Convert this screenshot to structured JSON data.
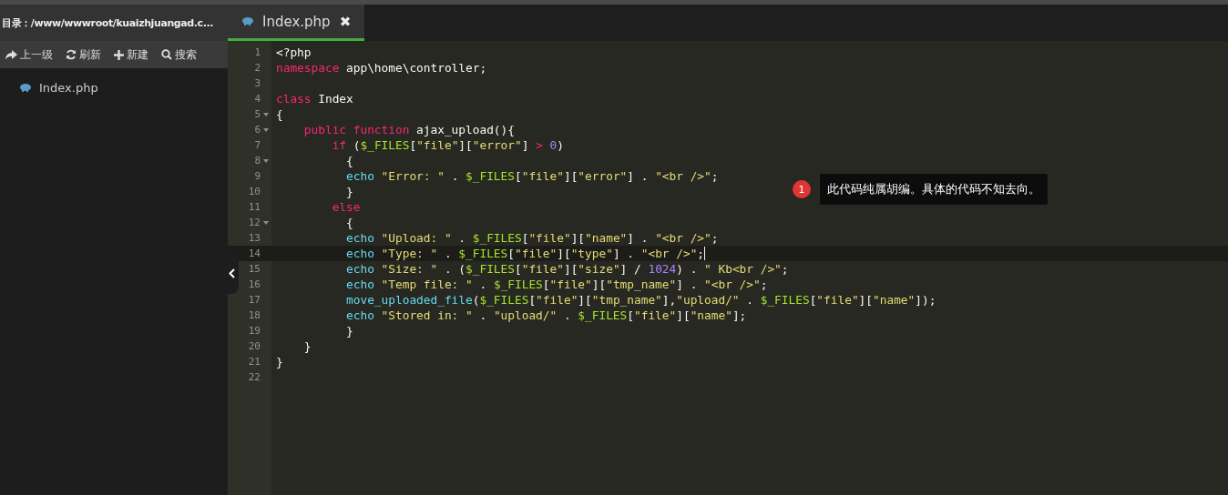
{
  "sidebar": {
    "path": "目录：/www/wwwroot/kuaizhjuangad.c...",
    "toolbar": [
      {
        "kind": "up",
        "label": "上一级"
      },
      {
        "kind": "refresh",
        "label": "刷新"
      },
      {
        "kind": "new",
        "label": "新建"
      },
      {
        "kind": "search",
        "label": "搜索"
      }
    ],
    "files": [
      {
        "name": "Index.php",
        "selected": false
      }
    ]
  },
  "tabs": [
    {
      "label": "Index.php",
      "close": "✖",
      "selected": true
    }
  ],
  "editor": {
    "lines": [
      {
        "number": "1",
        "fold": false,
        "active": false,
        "tokens": [
          {
            "kind": "plain",
            "text": "<?php"
          }
        ]
      },
      {
        "number": "2",
        "fold": false,
        "active": false,
        "tokens": [
          {
            "kind": "keyword",
            "text": "namespace"
          },
          {
            "kind": "plain",
            "text": " app\\home\\controller;"
          }
        ]
      },
      {
        "number": "3",
        "fold": false,
        "active": false
      },
      {
        "number": "4",
        "fold": false,
        "active": false,
        "tokens": [
          {
            "kind": "keyword",
            "text": "class"
          },
          {
            "kind": "plain",
            "text": " Index"
          }
        ]
      },
      {
        "number": "5",
        "fold": true,
        "active": false,
        "tokens": [
          {
            "kind": "plain",
            "text": "{"
          }
        ]
      },
      {
        "number": "6",
        "fold": true,
        "active": false,
        "tokens": [
          {
            "kind": "keyword",
            "text": "    public "
          },
          {
            "kind": "keyword",
            "text": "function"
          },
          {
            "kind": "plain",
            "text": " ajax_upload(){"
          }
        ]
      },
      {
        "number": "7",
        "fold": false,
        "active": false,
        "tokens": [
          {
            "kind": "keyword",
            "text": "        if"
          },
          {
            "kind": "plain",
            "text": " ("
          },
          {
            "kind": "variable",
            "text": "$_FILES"
          },
          {
            "kind": "plain",
            "text": "["
          },
          {
            "kind": "string",
            "text": "\"file\""
          },
          {
            "kind": "plain",
            "text": "]["
          },
          {
            "kind": "string",
            "text": "\"error\""
          },
          {
            "kind": "plain",
            "text": "] "
          },
          {
            "kind": "keyword",
            "text": "> "
          },
          {
            "kind": "number",
            "text": "0"
          },
          {
            "kind": "plain",
            "text": ")"
          }
        ]
      },
      {
        "number": "8",
        "fold": true,
        "active": false,
        "tokens": [
          {
            "kind": "plain",
            "text": "          {"
          }
        ]
      },
      {
        "number": "9",
        "fold": false,
        "active": false,
        "tokens": [
          {
            "kind": "builtin",
            "text": "          echo "
          },
          {
            "kind": "string",
            "text": "\"Error: \""
          },
          {
            "kind": "plain",
            "text": " . "
          },
          {
            "kind": "variable",
            "text": "$_FILES"
          },
          {
            "kind": "plain",
            "text": "["
          },
          {
            "kind": "string",
            "text": "\"file\""
          },
          {
            "kind": "plain",
            "text": "]["
          },
          {
            "kind": "string",
            "text": "\"error\""
          },
          {
            "kind": "plain",
            "text": "] . "
          },
          {
            "kind": "string",
            "text": "\"<br />\""
          },
          {
            "kind": "plain",
            "text": ";"
          }
        ]
      },
      {
        "number": "10",
        "fold": false,
        "active": false,
        "tokens": [
          {
            "kind": "plain",
            "text": "          }"
          }
        ]
      },
      {
        "number": "11",
        "fold": false,
        "active": false,
        "tokens": [
          {
            "kind": "keyword",
            "text": "        else"
          }
        ]
      },
      {
        "number": "12",
        "fold": true,
        "active": false,
        "tokens": [
          {
            "kind": "plain",
            "text": "          {"
          }
        ]
      },
      {
        "number": "13",
        "fold": false,
        "active": false,
        "tokens": [
          {
            "kind": "builtin",
            "text": "          echo "
          },
          {
            "kind": "string",
            "text": "\"Upload: \""
          },
          {
            "kind": "plain",
            "text": " . "
          },
          {
            "kind": "variable",
            "text": "$_FILES"
          },
          {
            "kind": "plain",
            "text": "["
          },
          {
            "kind": "string",
            "text": "\"file\""
          },
          {
            "kind": "plain",
            "text": "]["
          },
          {
            "kind": "string",
            "text": "\"name\""
          },
          {
            "kind": "plain",
            "text": "] . "
          },
          {
            "kind": "string",
            "text": "\"<br />\""
          },
          {
            "kind": "plain",
            "text": ";"
          }
        ]
      },
      {
        "number": "14",
        "fold": false,
        "active": true,
        "tokens": [
          {
            "kind": "builtin",
            "text": "          echo "
          },
          {
            "kind": "string",
            "text": "\"Type: \""
          },
          {
            "kind": "plain",
            "text": " . "
          },
          {
            "kind": "variable",
            "text": "$_FILES"
          },
          {
            "kind": "plain",
            "text": "["
          },
          {
            "kind": "string",
            "text": "\"file\""
          },
          {
            "kind": "plain",
            "text": "]["
          },
          {
            "kind": "string",
            "text": "\"type\""
          },
          {
            "kind": "plain",
            "text": "] . "
          },
          {
            "kind": "string",
            "text": "\"<br />\""
          },
          {
            "kind": "plain",
            "text": ";"
          }
        ]
      },
      {
        "number": "15",
        "fold": false,
        "active": false,
        "tokens": [
          {
            "kind": "builtin",
            "text": "          echo "
          },
          {
            "kind": "string",
            "text": "\"Size: \""
          },
          {
            "kind": "plain",
            "text": " . ("
          },
          {
            "kind": "variable",
            "text": "$_FILES"
          },
          {
            "kind": "plain",
            "text": "["
          },
          {
            "kind": "string",
            "text": "\"file\""
          },
          {
            "kind": "plain",
            "text": "]["
          },
          {
            "kind": "string",
            "text": "\"size\""
          },
          {
            "kind": "plain",
            "text": "] / "
          },
          {
            "kind": "number",
            "text": "1024"
          },
          {
            "kind": "plain",
            "text": ") . "
          },
          {
            "kind": "string",
            "text": "\" Kb<br />\""
          },
          {
            "kind": "plain",
            "text": ";"
          }
        ]
      },
      {
        "number": "16",
        "fold": false,
        "active": false,
        "tokens": [
          {
            "kind": "builtin",
            "text": "          echo "
          },
          {
            "kind": "string",
            "text": "\"Temp file: \""
          },
          {
            "kind": "plain",
            "text": " . "
          },
          {
            "kind": "variable",
            "text": "$_FILES"
          },
          {
            "kind": "plain",
            "text": "["
          },
          {
            "kind": "string",
            "text": "\"file\""
          },
          {
            "kind": "plain",
            "text": "]["
          },
          {
            "kind": "string",
            "text": "\"tmp_name\""
          },
          {
            "kind": "plain",
            "text": "] . "
          },
          {
            "kind": "string",
            "text": "\"<br />\""
          },
          {
            "kind": "plain",
            "text": ";"
          }
        ]
      },
      {
        "number": "17",
        "fold": false,
        "active": false,
        "tokens": [
          {
            "kind": "builtin",
            "text": "          move_uploaded_file"
          },
          {
            "kind": "plain",
            "text": "("
          },
          {
            "kind": "variable",
            "text": "$_FILES"
          },
          {
            "kind": "plain",
            "text": "["
          },
          {
            "kind": "string",
            "text": "\"file\""
          },
          {
            "kind": "plain",
            "text": "]["
          },
          {
            "kind": "string",
            "text": "\"tmp_name\""
          },
          {
            "kind": "plain",
            "text": "],"
          },
          {
            "kind": "string",
            "text": "\"upload/\""
          },
          {
            "kind": "plain",
            "text": " . "
          },
          {
            "kind": "variable",
            "text": "$_FILES"
          },
          {
            "kind": "plain",
            "text": "["
          },
          {
            "kind": "string",
            "text": "\"file\""
          },
          {
            "kind": "plain",
            "text": "]["
          },
          {
            "kind": "string",
            "text": "\"name\""
          },
          {
            "kind": "plain",
            "text": "]);"
          }
        ]
      },
      {
        "number": "18",
        "fold": false,
        "active": false,
        "tokens": [
          {
            "kind": "builtin",
            "text": "          echo "
          },
          {
            "kind": "string",
            "text": "\"Stored in: \""
          },
          {
            "kind": "plain",
            "text": " . "
          },
          {
            "kind": "string",
            "text": "\"upload/\""
          },
          {
            "kind": "plain",
            "text": " . "
          },
          {
            "kind": "variable",
            "text": "$_FILES"
          },
          {
            "kind": "plain",
            "text": "["
          },
          {
            "kind": "string",
            "text": "\"file\""
          },
          {
            "kind": "plain",
            "text": "]["
          },
          {
            "kind": "string",
            "text": "\"name\""
          },
          {
            "kind": "plain",
            "text": "];"
          }
        ]
      },
      {
        "number": "19",
        "fold": false,
        "active": false,
        "tokens": [
          {
            "kind": "plain",
            "text": "          }"
          }
        ]
      },
      {
        "number": "20",
        "fold": false,
        "active": false,
        "tokens": [
          {
            "kind": "plain",
            "text": "    }"
          }
        ]
      },
      {
        "number": "21",
        "fold": false,
        "active": false,
        "tokens": [
          {
            "kind": "plain",
            "text": "}"
          }
        ]
      },
      {
        "number": "22",
        "fold": false,
        "active": false
      }
    ]
  },
  "annotation": {
    "badge": "1",
    "text": "此代码纯属胡编。具体的代码不知去向。"
  }
}
